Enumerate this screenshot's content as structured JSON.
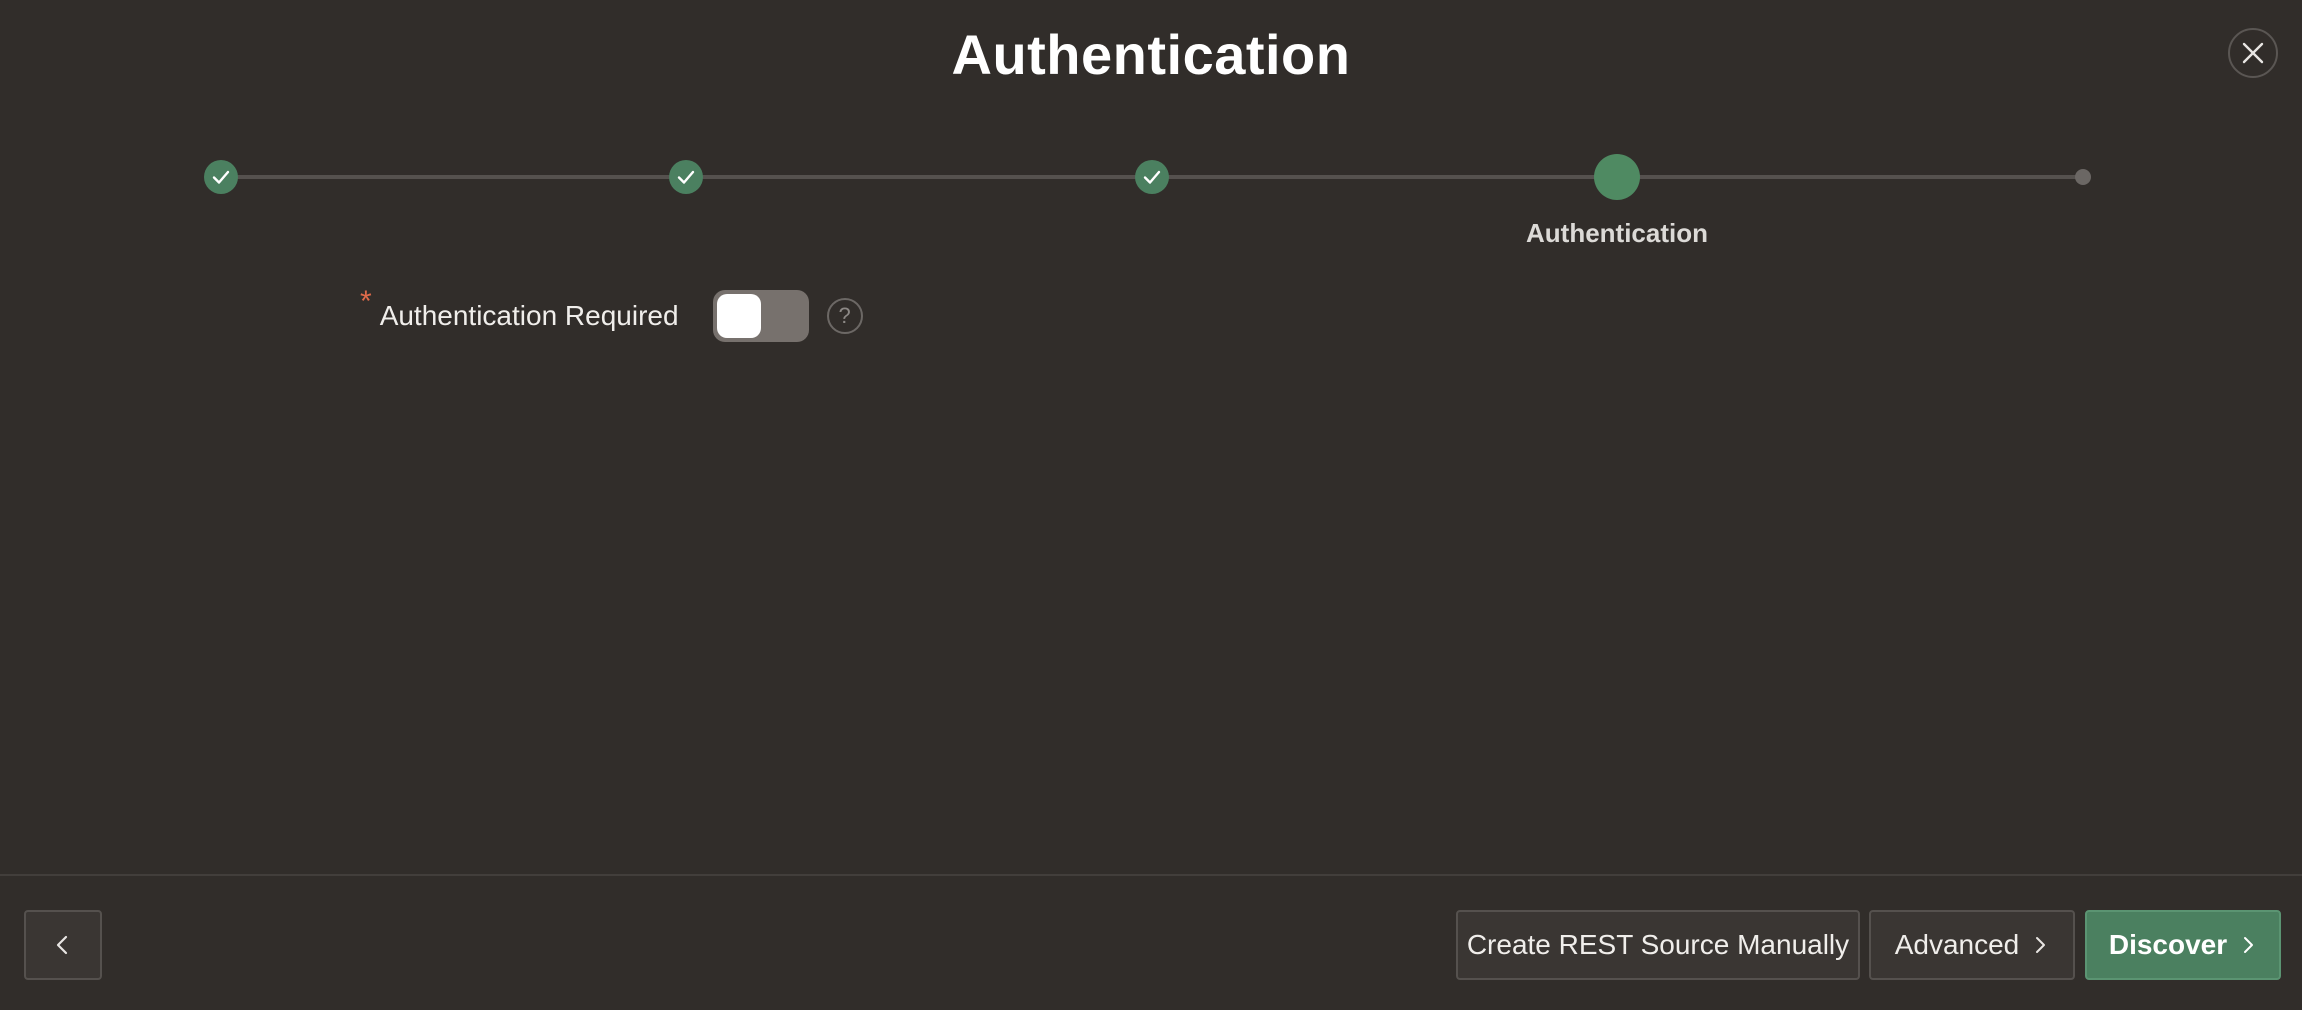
{
  "dialog": {
    "title": "Authentication",
    "close_icon": "close-icon"
  },
  "wizard": {
    "steps": [
      {
        "state": "completed",
        "label": ""
      },
      {
        "state": "completed",
        "label": ""
      },
      {
        "state": "completed",
        "label": ""
      },
      {
        "state": "current",
        "label": "Authentication"
      },
      {
        "state": "upcoming",
        "label": ""
      }
    ],
    "colors": {
      "completed": "#4b8060",
      "current": "#4f8a62",
      "upcoming": "#6b6764",
      "track": "#55514e"
    }
  },
  "form": {
    "auth_required": {
      "required_marker": "*",
      "label": "Authentication Required",
      "value": "off",
      "help_glyph": "?"
    }
  },
  "footer": {
    "back_icon": "chevron-left-icon",
    "create_manual_label": "Create REST Source Manually",
    "advanced_label": "Advanced",
    "discover_label": "Discover",
    "accent_color": "#4b8060"
  }
}
